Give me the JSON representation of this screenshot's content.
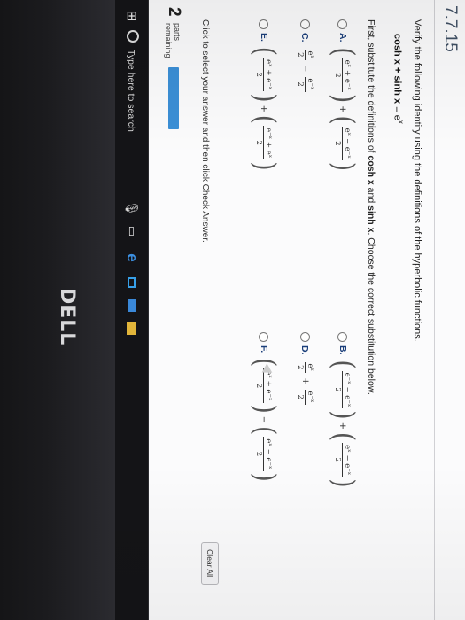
{
  "problem": {
    "number": "7.7.15",
    "instructions": "Verify the following identity using the definitions of the hyperbolic functions.",
    "identity": {
      "lhs_bold": "cosh x + sinh x",
      "rhs": "= e",
      "rhs_exp": "x"
    },
    "prompt_parts": [
      "First, substitute the definitions of ",
      "cosh x",
      " and ",
      "sinh x",
      ". Choose the correct substitution below."
    ]
  },
  "options": [
    {
      "letter": "A.",
      "terms": [
        {
          "paren": true,
          "num": "eˣ + e⁻ˣ",
          "den": "2"
        },
        {
          "op": "+"
        },
        {
          "paren": true,
          "num": "eˣ − e⁻ˣ",
          "den": "2"
        }
      ]
    },
    {
      "letter": "B.",
      "terms": [
        {
          "paren": true,
          "num": "e⁻ˣ − e⁻ˣ",
          "den": "2"
        },
        {
          "op": "+"
        },
        {
          "paren": true,
          "num": "eˣ − e⁻ˣ",
          "den": "2"
        }
      ]
    },
    {
      "letter": "C.",
      "terms": [
        {
          "paren": false,
          "num": "eˣ",
          "den": "2"
        },
        {
          "op": "−"
        },
        {
          "paren": false,
          "num": "e⁻ˣ",
          "den": "2"
        }
      ]
    },
    {
      "letter": "D.",
      "terms": [
        {
          "paren": false,
          "num": "eˣ",
          "den": "2"
        },
        {
          "op": "+"
        },
        {
          "paren": false,
          "num": "e⁻ˣ",
          "den": "2"
        }
      ]
    },
    {
      "letter": "E.",
      "terms": [
        {
          "paren": true,
          "num": "eˣ + e⁻ˣ",
          "den": "2"
        },
        {
          "op": "+"
        },
        {
          "paren": true,
          "num": "e⁻ˣ + eˣ",
          "den": "2"
        }
      ]
    },
    {
      "letter": "F.",
      "terms": [
        {
          "paren": true,
          "num": "eˣ + e⁻ˣ",
          "den": "2"
        },
        {
          "op": "−"
        },
        {
          "paren": true,
          "num": "eˣ − e⁻ˣ",
          "den": "2"
        }
      ]
    }
  ],
  "footer": {
    "click_message": "Click to select your answer and then click Check Answer.",
    "clear_all": "Clear All",
    "parts_count": "2",
    "parts_line1": "parts",
    "parts_line2": "remaining",
    "progress_fraction": 0.5
  },
  "taskbar": {
    "search_placeholder": "Type here to search",
    "windows_icon": "windows-logo-icon",
    "edge_glyph": "e"
  },
  "hardware": {
    "brand": "DELL"
  },
  "colors": {
    "accent": "#3b8fd6",
    "option_letter": "#1a3e7a"
  }
}
